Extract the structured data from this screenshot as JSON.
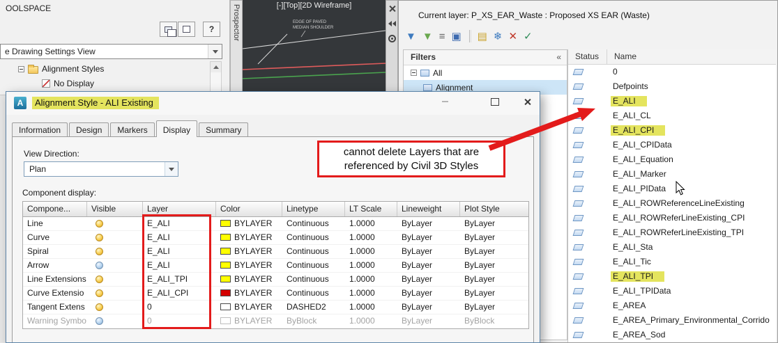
{
  "colors": {
    "annotation_red": "#e31b1b",
    "highlight_yellow": "#e4e45e",
    "selection_blue": "#cde5f7"
  },
  "toolspace": {
    "title": "OOLSPACE",
    "help_label": "?",
    "dropdown_value": "e Drawing Settings View",
    "tree": [
      {
        "label": "Alignment Styles"
      },
      {
        "label": "No Display"
      }
    ]
  },
  "viewport": {
    "title": "[-][Top][2D Wireframe]",
    "annotation_lines": [
      "EDGE OF PAVED",
      "MEDIAN SHOULDER"
    ],
    "palette_tab": "Prospector"
  },
  "dialog": {
    "icon_glyph": "A",
    "title": "Alignment Style - ALI Existing",
    "tabs": [
      "Information",
      "Design",
      "Markers",
      "Display",
      "Summary"
    ],
    "active_tab": "Display",
    "view_direction_label": "View Direction:",
    "view_direction_value": "Plan",
    "component_display_label": "Component display:",
    "table": {
      "headers": [
        "Compone...",
        "Visible",
        "Layer",
        "Color",
        "Linetype",
        "LT Scale",
        "Lineweight",
        "Plot Style"
      ],
      "rows": [
        {
          "component": "Line",
          "visible_on": true,
          "layer": "E_ALI",
          "swatch": "#ffff00",
          "color": "BYLAYER",
          "linetype": "Continuous",
          "lt_scale": "1.0000",
          "lineweight": "ByLayer",
          "plot_style": "ByLayer",
          "dimmed": false
        },
        {
          "component": "Curve",
          "visible_on": true,
          "layer": "E_ALI",
          "swatch": "#ffff00",
          "color": "BYLAYER",
          "linetype": "Continuous",
          "lt_scale": "1.0000",
          "lineweight": "ByLayer",
          "plot_style": "ByLayer",
          "dimmed": false
        },
        {
          "component": "Spiral",
          "visible_on": true,
          "layer": "E_ALI",
          "swatch": "#ffff00",
          "color": "BYLAYER",
          "linetype": "Continuous",
          "lt_scale": "1.0000",
          "lineweight": "ByLayer",
          "plot_style": "ByLayer",
          "dimmed": false
        },
        {
          "component": "Arrow",
          "visible_on": false,
          "layer": "E_ALI",
          "swatch": "#ffff00",
          "color": "BYLAYER",
          "linetype": "Continuous",
          "lt_scale": "1.0000",
          "lineweight": "ByLayer",
          "plot_style": "ByLayer",
          "dimmed": false
        },
        {
          "component": "Line Extensions",
          "visible_on": true,
          "layer": "E_ALI_TPI",
          "swatch": "#ffff00",
          "color": "BYLAYER",
          "linetype": "Continuous",
          "lt_scale": "1.0000",
          "lineweight": "ByLayer",
          "plot_style": "ByLayer",
          "dimmed": false
        },
        {
          "component": "Curve Extensio",
          "visible_on": true,
          "layer": "E_ALI_CPI",
          "swatch": "#d40000",
          "color": "BYLAYER",
          "linetype": "Continuous",
          "lt_scale": "1.0000",
          "lineweight": "ByLayer",
          "plot_style": "ByLayer",
          "dimmed": false
        },
        {
          "component": "Tangent Extens",
          "visible_on": true,
          "layer": "0",
          "swatch": "#ffffff",
          "color": "BYLAYER",
          "linetype": "DASHED2",
          "lt_scale": "1.0000",
          "lineweight": "ByLayer",
          "plot_style": "ByLayer",
          "dimmed": false
        },
        {
          "component": "Warning Symbo",
          "visible_on": false,
          "layer": "0",
          "swatch": "#ffffff",
          "color": "BYLAYER",
          "linetype": "ByBlock",
          "lt_scale": "1.0000",
          "lineweight": "ByLayer",
          "plot_style": "ByBlock",
          "dimmed": true
        }
      ]
    }
  },
  "callout": {
    "line1": "cannot delete Layers that are",
    "line2": "referenced by Civil 3D Styles"
  },
  "layer_manager": {
    "current_layer": "Current layer: P_XS_EAR_Waste : Proposed XS EAR (Waste)",
    "filters_label": "Filters",
    "collapse_glyph": "«",
    "toolbar_icons": [
      {
        "name": "new-property-filter",
        "glyph": "▼",
        "color": "#3e7bbf"
      },
      {
        "name": "new-group-filter",
        "glyph": "▼",
        "color": "#6aa84f"
      },
      {
        "name": "layer-states-manager",
        "glyph": "≡",
        "color": "#666666"
      },
      {
        "name": "save-layer-state",
        "glyph": "▣",
        "color": "#3e6bb0"
      },
      {
        "name": "new-layer",
        "glyph": "▤",
        "color": "#c9a227"
      },
      {
        "name": "new-layer-frozen",
        "glyph": "❄",
        "color": "#3e7bbf"
      },
      {
        "name": "delete-layer",
        "glyph": "✕",
        "color": "#c0392b"
      },
      {
        "name": "set-current",
        "glyph": "✓",
        "color": "#2e8b57"
      }
    ],
    "filter_tree": [
      {
        "label": "All",
        "level": 0,
        "selected": false
      },
      {
        "label": "Alignment",
        "level": 1,
        "selected": true
      }
    ],
    "columns": [
      "Status",
      "Name"
    ],
    "layers": [
      {
        "name": "0",
        "highlighted": false
      },
      {
        "name": "Defpoints",
        "highlighted": false
      },
      {
        "name": "E_ALI",
        "highlighted": true
      },
      {
        "name": "E_ALI_CL",
        "highlighted": false
      },
      {
        "name": "E_ALI_CPI",
        "highlighted": true
      },
      {
        "name": "E_ALI_CPIData",
        "highlighted": false
      },
      {
        "name": "E_ALI_Equation",
        "highlighted": false
      },
      {
        "name": "E_ALI_Marker",
        "highlighted": false
      },
      {
        "name": "E_ALI_PIData",
        "highlighted": false
      },
      {
        "name": "E_ALI_ROWReferenceLineExisting",
        "highlighted": false
      },
      {
        "name": "E_ALI_ROWReferLineExisting_CPI",
        "highlighted": false
      },
      {
        "name": "E_ALI_ROWReferLineExisting_TPI",
        "highlighted": false
      },
      {
        "name": "E_ALI_Sta",
        "highlighted": false
      },
      {
        "name": "E_ALI_Tic",
        "highlighted": false
      },
      {
        "name": "E_ALI_TPI",
        "highlighted": true
      },
      {
        "name": "E_ALI_TPIData",
        "highlighted": false
      },
      {
        "name": "E_AREA",
        "highlighted": false
      },
      {
        "name": "E_AREA_Primary_Environmental_Corrido",
        "highlighted": false
      },
      {
        "name": "E_AREA_Sod",
        "highlighted": false
      }
    ]
  }
}
